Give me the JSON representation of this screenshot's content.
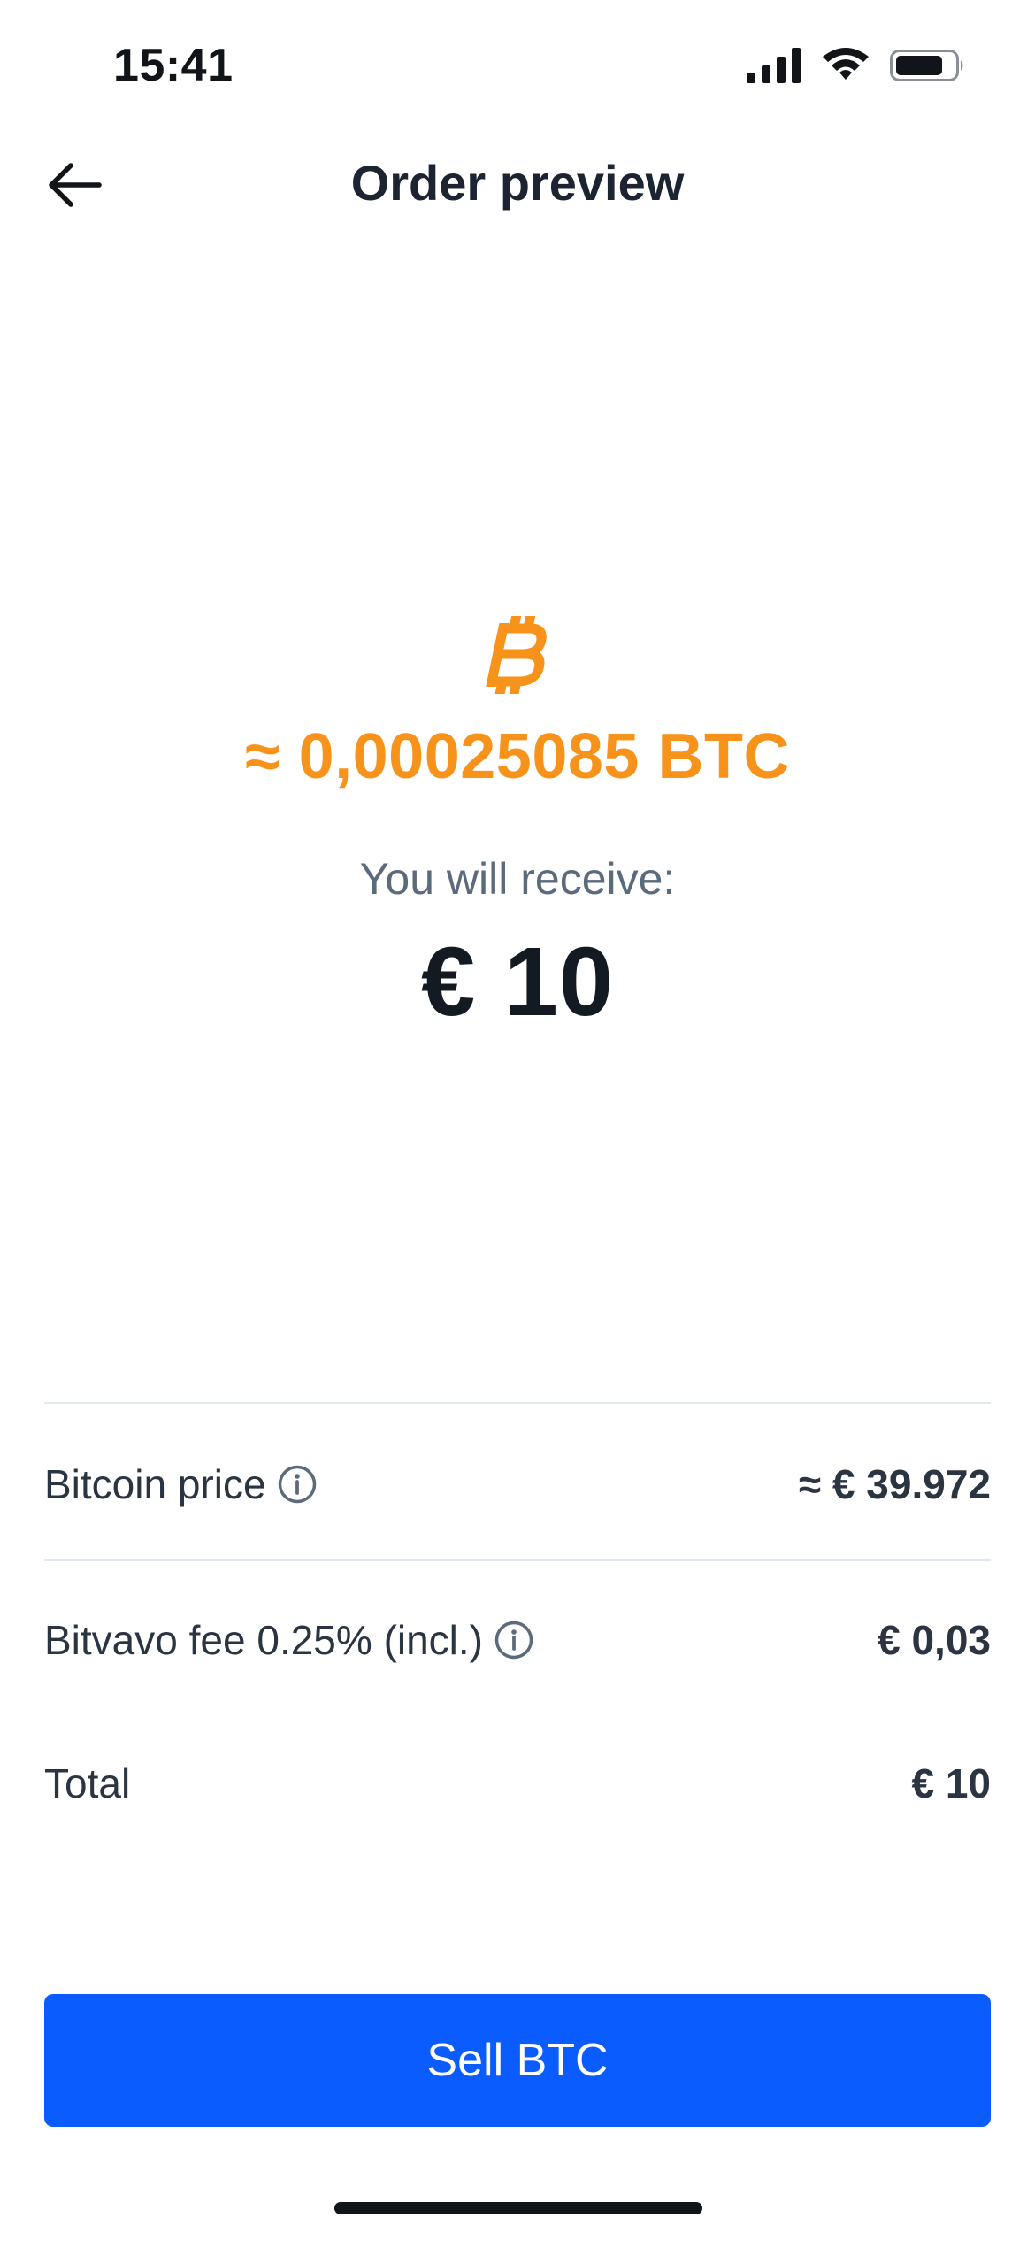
{
  "status_bar": {
    "time": "15:41",
    "icons": [
      "signal-icon",
      "wifi-icon",
      "battery-icon"
    ]
  },
  "header": {
    "back_icon": "arrow-left-icon",
    "title": "Order preview"
  },
  "hero": {
    "coin_icon": "bitcoin-icon",
    "btc_amount": "≈ 0,00025085 BTC",
    "receive_label": "You will receive:",
    "receive_value": "€ 10"
  },
  "details": {
    "price": {
      "label": "Bitcoin price",
      "value": "≈ € 39.972",
      "icon": "info-icon"
    },
    "fee": {
      "label": "Bitvavo fee 0.25% (incl.)",
      "value": "€ 0,03",
      "icon": "info-icon"
    },
    "total": {
      "label": "Total",
      "value": "€ 10"
    }
  },
  "action": {
    "sell_label": "Sell BTC"
  },
  "colors": {
    "accent": "#0a5cff",
    "bitcoin": "#f7931a",
    "text": "#1b2430",
    "muted": "#5c6b7c",
    "divider": "#e2e8ef"
  }
}
